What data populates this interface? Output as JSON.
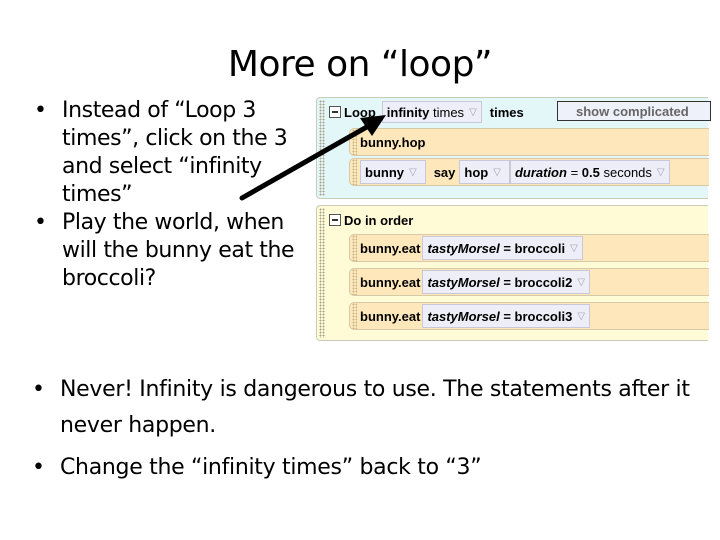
{
  "slide": {
    "title": "More on “loop”",
    "bullets_top": [
      "Instead of “Loop 3 times”, click on the 3 and select “infinity times”",
      "Play the world, when will the bunny eat the broccoli?"
    ],
    "bullets_bottom": [
      "Never! Infinity is dangerous to use.  The statements after it never happen.",
      "Change the “infinity times” back to “3”"
    ],
    "bullet_glyph": "•"
  },
  "code": {
    "loop": {
      "keyword": "Loop",
      "count_value": "infinity",
      "count_unit": "times",
      "times_label": "times",
      "show_complicated": "show complicated",
      "statements": {
        "hop": "bunny.hop",
        "say_object": "bunny",
        "say_verb": "say",
        "say_text": "hop",
        "duration_label": "duration",
        "duration_eq": "=",
        "duration_value": "0.5",
        "duration_unit": "seconds"
      }
    },
    "do_in_order": {
      "label": "Do in order",
      "statements": [
        {
          "method": "bunny.eat",
          "param": "tastyMorsel",
          "eq": "=",
          "value": "broccoli"
        },
        {
          "method": "bunny.eat",
          "param": "tastyMorsel",
          "eq": "=",
          "value": "broccoli2"
        },
        {
          "method": "bunny.eat",
          "param": "tastyMorsel",
          "eq": "=",
          "value": "broccoli3"
        }
      ]
    },
    "dropdown_glyph": "▽"
  }
}
